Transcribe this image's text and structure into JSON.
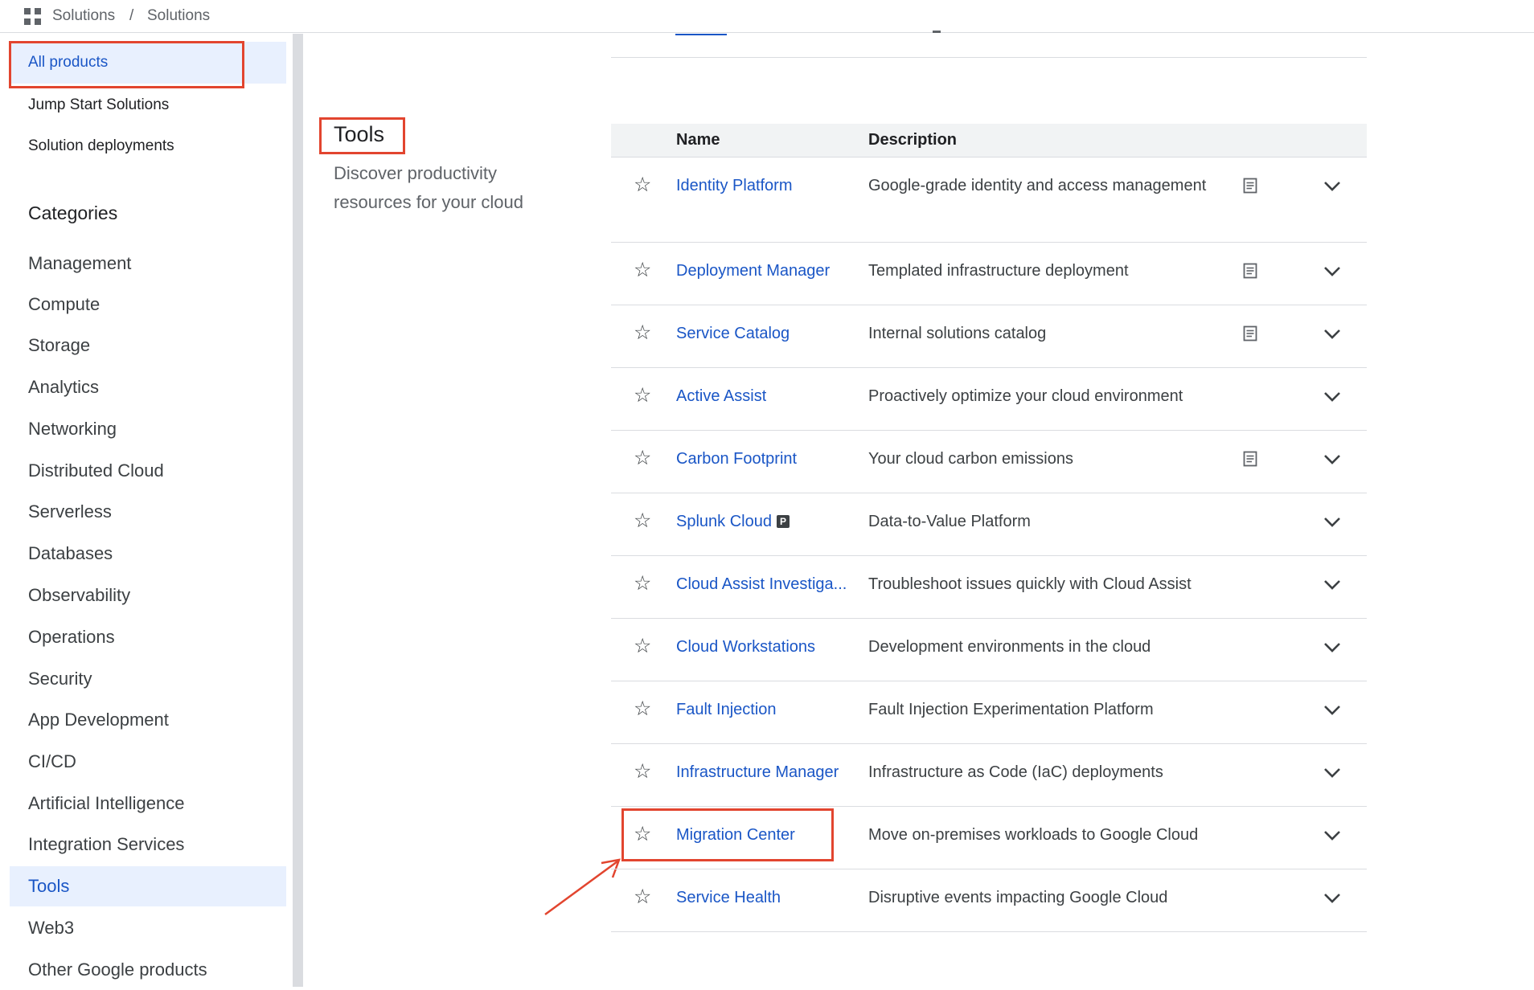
{
  "breadcrumb": {
    "first": "Solutions",
    "separator": "/",
    "second": "Solutions"
  },
  "sidebar": {
    "top_items": [
      "All products",
      "Jump Start Solutions",
      "Solution deployments"
    ],
    "categories_heading": "Categories",
    "categories": [
      "Management",
      "Compute",
      "Storage",
      "Analytics",
      "Networking",
      "Distributed Cloud",
      "Serverless",
      "Databases",
      "Observability",
      "Operations",
      "Security",
      "App Development",
      "CI/CD",
      "Artificial Intelligence",
      "Integration Services",
      "Tools",
      "Web3",
      "Other Google products"
    ],
    "selected_category": "Tools"
  },
  "section": {
    "title": "Tools",
    "description": "Discover productivity resources for your cloud"
  },
  "table": {
    "headers": {
      "name": "Name",
      "description": "Description"
    },
    "rows": [
      {
        "name": "Identity Platform",
        "description": "Google-grade identity and access management",
        "doc": true,
        "badge": ""
      },
      {
        "name": "Deployment Manager",
        "description": "Templated infrastructure deployment",
        "doc": true,
        "badge": ""
      },
      {
        "name": "Service Catalog",
        "description": "Internal solutions catalog",
        "doc": true,
        "badge": ""
      },
      {
        "name": "Active Assist",
        "description": "Proactively optimize your cloud environment",
        "doc": false,
        "badge": ""
      },
      {
        "name": "Carbon Footprint",
        "description": "Your cloud carbon emissions",
        "doc": true,
        "badge": ""
      },
      {
        "name": "Splunk Cloud",
        "description": "Data-to-Value Platform",
        "doc": false,
        "badge": "P"
      },
      {
        "name": "Cloud Assist Investiga...",
        "description": "Troubleshoot issues quickly with Cloud Assist",
        "doc": false,
        "badge": ""
      },
      {
        "name": "Cloud Workstations",
        "description": "Development environments in the cloud",
        "doc": false,
        "badge": ""
      },
      {
        "name": "Fault Injection",
        "description": "Fault Injection Experimentation Platform",
        "doc": false,
        "badge": ""
      },
      {
        "name": "Infrastructure Manager",
        "description": "Infrastructure as Code (IaC) deployments",
        "doc": false,
        "badge": ""
      },
      {
        "name": "Migration Center",
        "description": "Move on-premises workloads to Google Cloud",
        "doc": false,
        "badge": ""
      },
      {
        "name": "Service Health",
        "description": "Disruptive events impacting Google Cloud",
        "doc": false,
        "badge": ""
      }
    ]
  },
  "icons": {
    "star": "star-outline-icon",
    "doc": "document-icon",
    "expand": "chevron-down-icon",
    "apps": "apps-grid-icon"
  },
  "colors": {
    "link": "#1a56c6",
    "selected_bg": "#e8f0fe",
    "highlight_box": "#e2452f"
  }
}
